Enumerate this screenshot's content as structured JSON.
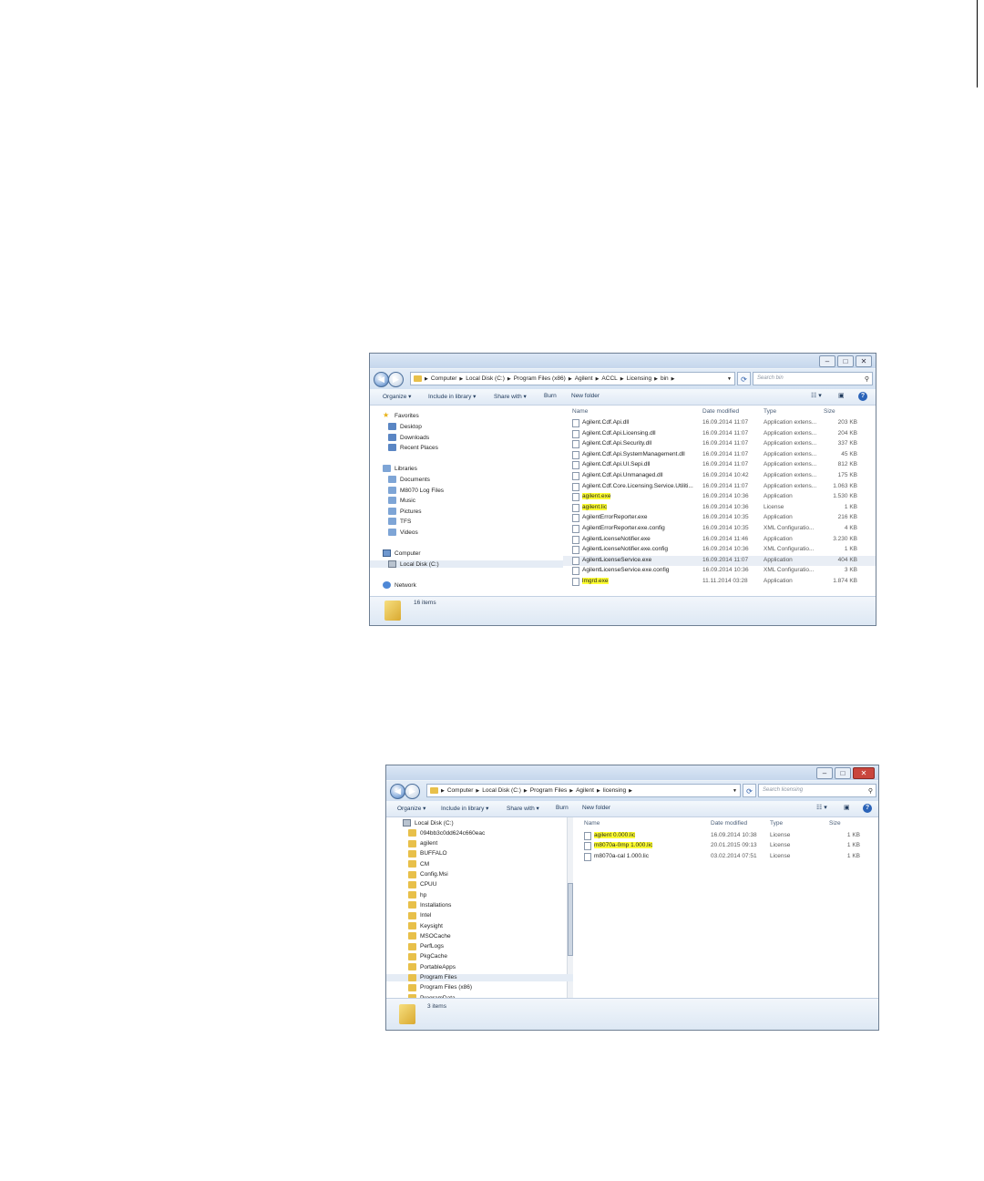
{
  "window1": {
    "breadcrumb": [
      "Computer",
      "Local Disk (C:)",
      "Program Files (x86)",
      "Agilent",
      "ACCL",
      "Licensing",
      "bin"
    ],
    "search_placeholder": "Search bin",
    "toolbar": {
      "organize": "Organize ▾",
      "include": "Include in library ▾",
      "share": "Share with ▾",
      "burn": "Burn",
      "new_folder": "New folder"
    },
    "columns": {
      "name": "Name",
      "date": "Date modified",
      "type": "Type",
      "size": "Size"
    },
    "nav": [
      {
        "label": "Favorites",
        "icon": "star-icon"
      },
      {
        "label": "Desktop",
        "icon": "desktop-icon"
      },
      {
        "label": "Downloads",
        "icon": "downloads-icon"
      },
      {
        "label": "Recent Places",
        "icon": "recent-places-icon"
      },
      {
        "label": "Libraries",
        "icon": "libraries-icon"
      },
      {
        "label": "Documents",
        "icon": "documents-icon"
      },
      {
        "label": "M8070 Log Files",
        "icon": "library-icon"
      },
      {
        "label": "Music",
        "icon": "music-icon"
      },
      {
        "label": "Pictures",
        "icon": "pictures-icon"
      },
      {
        "label": "TFS",
        "icon": "library-icon"
      },
      {
        "label": "Videos",
        "icon": "videos-icon"
      },
      {
        "label": "Computer",
        "icon": "computer-icon"
      },
      {
        "label": "Local Disk (C:)",
        "icon": "disk-icon"
      },
      {
        "label": "Network",
        "icon": "network-icon"
      }
    ],
    "files": [
      {
        "name": "Agilent.Cdf.Api.dll",
        "date": "16.09.2014 11:07",
        "type": "Application extens...",
        "size": "203 KB"
      },
      {
        "name": "Agilent.Cdf.Api.Licensing.dll",
        "date": "16.09.2014 11:07",
        "type": "Application extens...",
        "size": "204 KB"
      },
      {
        "name": "Agilent.Cdf.Api.Security.dll",
        "date": "16.09.2014 11:07",
        "type": "Application extens...",
        "size": "337 KB"
      },
      {
        "name": "Agilent.Cdf.Api.SystemManagement.dll",
        "date": "16.09.2014 11:07",
        "type": "Application extens...",
        "size": "45 KB"
      },
      {
        "name": "Agilent.Cdf.Api.UI.Sepi.dll",
        "date": "16.09.2014 11:07",
        "type": "Application extens...",
        "size": "812 KB"
      },
      {
        "name": "Agilent.Cdf.Api.Unmanaged.dll",
        "date": "16.09.2014 10:42",
        "type": "Application extens...",
        "size": "175 KB"
      },
      {
        "name": "Agilent.Cdf.Core.Licensing.Service.Utiliti...",
        "date": "16.09.2014 11:07",
        "type": "Application extens...",
        "size": "1.063 KB"
      },
      {
        "name": "agilent.exe",
        "date": "16.09.2014 10:36",
        "type": "Application",
        "size": "1.530 KB"
      },
      {
        "name": "agilent.lic",
        "date": "16.09.2014 10:36",
        "type": "License",
        "size": "1 KB"
      },
      {
        "name": "AgilentErrorReporter.exe",
        "date": "16.09.2014 10:35",
        "type": "Application",
        "size": "216 KB"
      },
      {
        "name": "AgilentErrorReporter.exe.config",
        "date": "16.09.2014 10:35",
        "type": "XML Configuratio...",
        "size": "4 KB"
      },
      {
        "name": "AgilentLicenseNotifier.exe",
        "date": "16.09.2014 11:46",
        "type": "Application",
        "size": "3.230 KB"
      },
      {
        "name": "AgilentLicenseNotifier.exe.config",
        "date": "16.09.2014 10:36",
        "type": "XML Configuratio...",
        "size": "1 KB"
      },
      {
        "name": "AgilentLicenseService.exe",
        "date": "16.09.2014 11:07",
        "type": "Application",
        "size": "404 KB"
      },
      {
        "name": "AgilentLicenseService.exe.config",
        "date": "16.09.2014 10:36",
        "type": "XML Configuratio...",
        "size": "3 KB"
      },
      {
        "name": "lmgrd.exe",
        "date": "11.11.2014 03:28",
        "type": "Application",
        "size": "1.874 KB"
      }
    ],
    "status": "16 items"
  },
  "window2": {
    "breadcrumb": [
      "Computer",
      "Local Disk (C:)",
      "Program Files",
      "Agilent",
      "licensing"
    ],
    "search_placeholder": "Search licensing",
    "toolbar": {
      "organize": "Organize ▾",
      "include": "Include in library ▾",
      "share": "Share with ▾",
      "burn": "Burn",
      "new_folder": "New folder"
    },
    "columns": {
      "name": "Name",
      "date": "Date modified",
      "type": "Type",
      "size": "Size"
    },
    "tree": [
      "Local Disk (C:)",
      "094bb3c0dd624c660eac",
      "agilent",
      "BUFFALO",
      "CM",
      "Config.Msi",
      "CPUU",
      "hp",
      "Installations",
      "Intel",
      "Keysight",
      "MSOCache",
      "PerfLogs",
      "PkgCache",
      "PortableApps",
      "Program Files",
      "Program Files (x86)",
      "ProgramData"
    ],
    "files": [
      {
        "name": "agilent 0.000.lic",
        "date": "16.09.2014 10:38",
        "type": "License",
        "size": "1 KB"
      },
      {
        "name": "m8070a-0mp 1.000.lic",
        "date": "20.01.2015 09:13",
        "type": "License",
        "size": "1 KB"
      },
      {
        "name": "m8070a-cal 1.000.lic",
        "date": "03.02.2014 07:51",
        "type": "License",
        "size": "1 KB"
      }
    ],
    "status": "3 items"
  }
}
